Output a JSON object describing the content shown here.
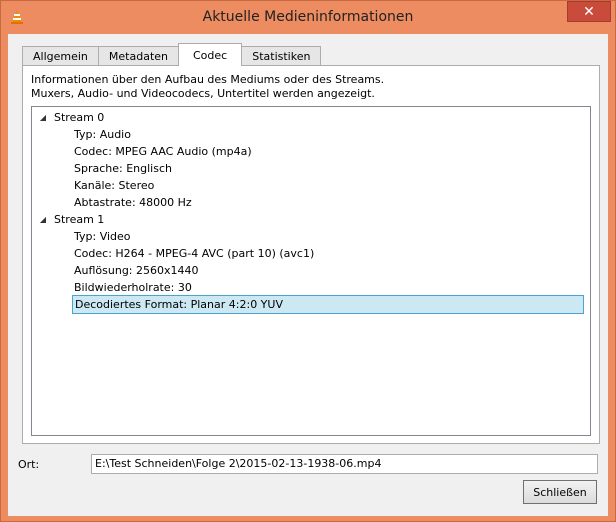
{
  "window": {
    "title": "Aktuelle Medieninformationen",
    "close_glyph": "✕"
  },
  "tabs": [
    {
      "label": "Allgemein",
      "active": false
    },
    {
      "label": "Metadaten",
      "active": false
    },
    {
      "label": "Codec",
      "active": true
    },
    {
      "label": "Statistiken",
      "active": false
    }
  ],
  "description": {
    "line1": "Informationen über den Aufbau des Mediums oder des Streams.",
    "line2": "Muxers, Audio- und Videocodecs, Untertitel werden angezeigt."
  },
  "tree": {
    "stream0": {
      "label": "Stream 0",
      "items": [
        "Typ: Audio",
        "Codec: MPEG AAC Audio (mp4a)",
        "Sprache: Englisch",
        "Kanäle: Stereo",
        "Abtastrate: 48000 Hz"
      ]
    },
    "stream1": {
      "label": "Stream 1",
      "items": [
        "Typ: Video",
        "Codec: H264 - MPEG-4 AVC (part 10) (avc1)",
        "Auflösung: 2560x1440",
        "Bildwiederholrate: 30",
        "Decodiertes Format: Planar 4:2:0 YUV"
      ]
    },
    "expander_glyph": "◢"
  },
  "location": {
    "label": "Ort:",
    "value": "E:\\Test Schneiden\\Folge 2\\2015-02-13-1938-06.mp4"
  },
  "buttons": {
    "close_label": "Schließen"
  },
  "colors": {
    "frame": "#ec8c60",
    "close_button": "#c84b3c",
    "selection": "#cce8f3"
  }
}
